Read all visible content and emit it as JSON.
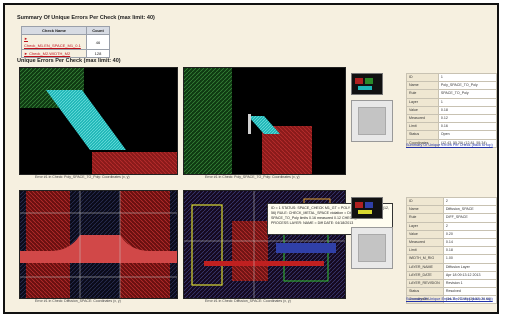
{
  "page": {
    "summary_title": "Summary Of Unique Errors Per Check (max limit: 40)",
    "sub_title": "Unique Errors Per Check (max limit: 40)"
  },
  "summary_table": {
    "headers": [
      "Check Name",
      "Count"
    ],
    "rows": [
      {
        "name": "► Check_M1.EN_SPACE_M1_0.1",
        "count": "46"
      },
      {
        "name": "► Check_M2.WIDTH_M2",
        "count": "128"
      }
    ]
  },
  "screenshots": [
    {
      "caption": "Error #1 in Check: Poly_SPACE_TO_Poly: Coordinates (x, y)"
    },
    {
      "caption": "Error #1 in Check: Poly_SPACE_TO_Poly: Coordinates (x, y)"
    },
    {
      "caption": "Error #1 in Check: Diffusion_SPACE: Coordinates (x, y)"
    },
    {
      "caption": "Error #1 in Check: Diffusion_SPACE: Coordinates (x, y)"
    }
  ],
  "detail_panels": [
    {
      "rows": [
        {
          "key": "ID",
          "value": "1"
        },
        {
          "key": "Name",
          "value": "Poly_SPACE_TO_Poly"
        },
        {
          "key": "Rule",
          "value": "SPACE_TO_Poly"
        },
        {
          "key": "Layer",
          "value": "1"
        },
        {
          "key": "Value",
          "value": "0.18"
        },
        {
          "key": "Measured",
          "value": "0.12"
        },
        {
          "key": "Limit",
          "value": "0.16"
        },
        {
          "key": "Status",
          "value": "Open"
        },
        {
          "key": "Coordinates",
          "value": "(12.43, 55.20) (12.81, 55.34)"
        }
      ],
      "link": "Summary Of Unique Errors Per Check (back to top)"
    },
    {
      "rows": [
        {
          "key": "ID",
          "value": "2"
        },
        {
          "key": "Name",
          "value": "Diffusion_SPACE"
        },
        {
          "key": "Rule",
          "value": "DIFF_SPACE"
        },
        {
          "key": "Layer",
          "value": "2"
        },
        {
          "key": "Value",
          "value": "0.20"
        },
        {
          "key": "Measured",
          "value": "0.14"
        },
        {
          "key": "Limit",
          "value": "0.18"
        },
        {
          "key": "WIDTH_M_RIG",
          "value": "1.00"
        },
        {
          "key": "LAYER_NAME",
          "value": "Diffusion Layer"
        },
        {
          "key": "LAYER_DATE",
          "value": "Apr 18 09:13:12 2013"
        },
        {
          "key": "LAYER_REVISION",
          "value": "Revision 1"
        },
        {
          "key": "Status",
          "value": "Resolved"
        },
        {
          "key": "Coordinates",
          "value": "(34.11, 20.45) (34.52, 20.60)"
        }
      ],
      "link": "Summary Of Unique Errors Per Check (back to top)"
    }
  ],
  "tooltip": {
    "text": "ID = 1 STATUS: SPACE_CHECK M1_GT = POLY  coordinates (x, y) = (12, 56) RULE: CHECK_METAL_SPACE  violation = Diffusion SPACE_TO_Poly limits 0.16  measured 0.12  CHECK_LAYER = PROCESS  LAYER: NAME = Diff  DATE: 04/18/2013"
  }
}
